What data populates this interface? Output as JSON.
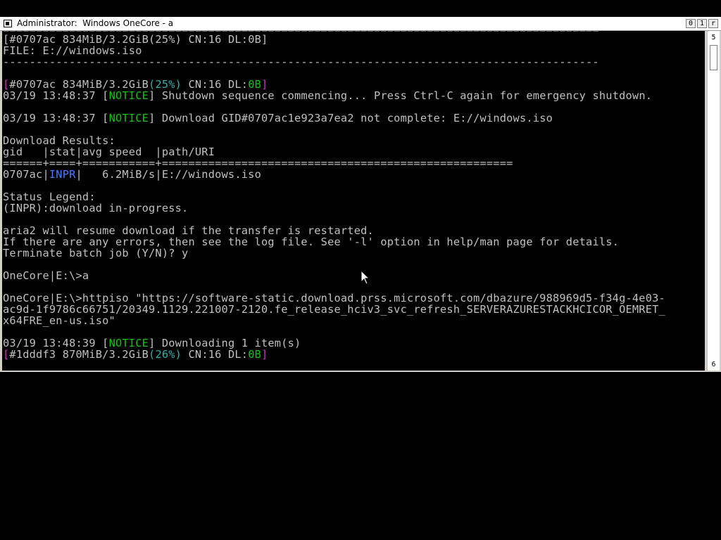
{
  "window": {
    "title": "Administrator:  Windows OneCore - a",
    "controls": {
      "minimize": "0",
      "maximize": "1",
      "close": "r"
    }
  },
  "scrollbar": {
    "up_glyph": "5",
    "down_glyph": "6"
  },
  "console": {
    "sep_double": "==========================================================================================",
    "status1": {
      "gid": "[#0707ac",
      "size": "834MiB/3.2GiB(25%)",
      "cn": "CN:16",
      "dl": "DL:0B]"
    },
    "file_line": "FILE: E://windows.iso",
    "sep_dash": "------------------------------------------------------------------------------------------",
    "status2": {
      "open": "[",
      "gid": "#0707ac 834MiB/3.2GiB",
      "pct": "(25%)",
      "cn": " CN:16 DL:",
      "dl_val": "0B",
      "close": "]"
    },
    "notice1": {
      "time": "03/19 13:48:37 [",
      "tag": "NOTICE",
      "msg": "] Shutdown sequence commencing... Press Ctrl-C again for emergency shutdown."
    },
    "notice2": {
      "time": "03/19 13:48:37 [",
      "tag": "NOTICE",
      "msg": "] Download GID#0707ac1e923a7ea2 not complete: E://windows.iso"
    },
    "results_title": "Download Results:",
    "results_header": "gid   |stat|avg speed  |path/URI",
    "results_sep": "======+====+===========+=====================================================",
    "result_row": {
      "gid": "0707ac|",
      "stat": "INPR",
      "rest": "|   6.2MiB/s|E://windows.iso"
    },
    "legend_title": "Status Legend:",
    "legend_item": "(INPR):download in-progress.",
    "resume_msg": "aria2 will resume download if the transfer is restarted.",
    "errors_msg": "If there are any errors, then see the log file. See '-l' option in help/man page for details.",
    "terminate_prompt": "Terminate batch job (Y/N)? y",
    "prompt_a": "OneCore|E:\\>a",
    "cmd_line1": "OneCore|E:\\>httpiso \"https://software-static.download.prss.microsoft.com/dbazure/988969d5-f34g-4e03-",
    "cmd_line2": "ac9d-1f9786c66751/20349.1129.221007-2120.fe_release_hciv3_svc_refresh_SERVERAZURESTACKHCICOR_OEMRET_",
    "cmd_line3": "x64FRE_en-us.iso\"",
    "notice3": {
      "time": "03/19 13:48:39 [",
      "tag": "NOTICE",
      "msg": "] Downloading 1 item(s)"
    },
    "status3": {
      "open": "[",
      "gid": "#1dddf3 870MiB/3.2GiB",
      "pct": "(26%)",
      "cn": " CN:16 DL:",
      "dl_val": "0B",
      "close": "]"
    }
  },
  "colors": {
    "notice": "#13c213",
    "percent": "#2fb0b0",
    "bracket": "#b93db9",
    "inpr": "#4a7cff",
    "text": "#c0c0c0",
    "background": "#000000"
  }
}
